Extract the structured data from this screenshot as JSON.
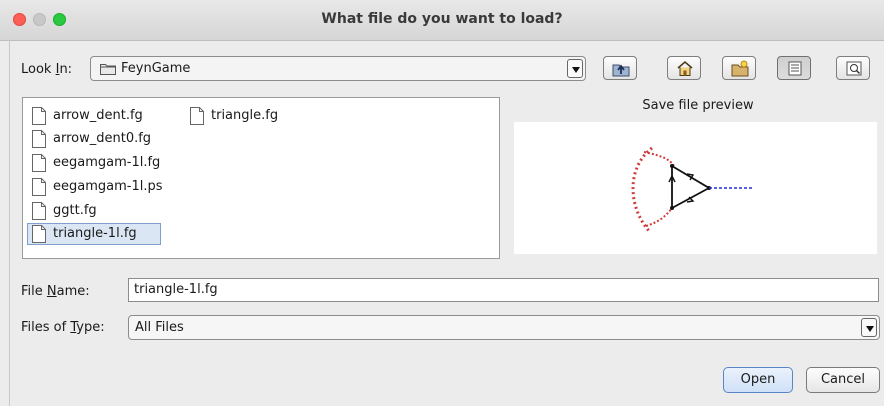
{
  "window": {
    "title": "What file do you want to load?"
  },
  "look_in": {
    "label_prefix": "Look ",
    "label_mnemonic": "I",
    "label_suffix": "n:",
    "value": "FeynGame"
  },
  "toolbar": [
    "up-one-level",
    "home",
    "new-folder",
    "list-view",
    "details-view"
  ],
  "files": [
    {
      "name": "arrow_dent.fg",
      "selected": false
    },
    {
      "name": "arrow_dent0.fg",
      "selected": false
    },
    {
      "name": "eegamgam-1l.fg",
      "selected": false
    },
    {
      "name": "eegamgam-1l.ps",
      "selected": false
    },
    {
      "name": "ggtt.fg",
      "selected": false
    },
    {
      "name": "triangle-1l.fg",
      "selected": true
    },
    {
      "name": "triangle.fg",
      "selected": false
    }
  ],
  "preview": {
    "title": "Save file preview"
  },
  "file_name": {
    "label_prefix": "File ",
    "label_mnemonic": "N",
    "label_suffix": "ame:",
    "value": "triangle-1l.fg"
  },
  "file_type": {
    "label_prefix": "Files of ",
    "label_mnemonic": "T",
    "label_suffix": "ype:",
    "value": "All Files"
  },
  "buttons": {
    "open": "Open",
    "cancel": "Cancel"
  },
  "colors": {
    "selection": "#dbe6f4",
    "gluon": "#d23a3a",
    "scalar": "#1f2fd6"
  }
}
